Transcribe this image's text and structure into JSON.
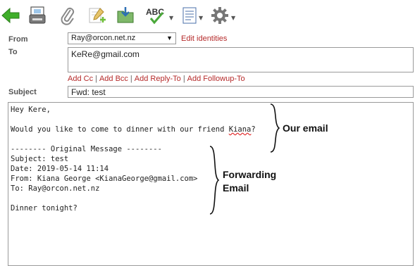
{
  "toolbar": {
    "items": [
      {
        "name": "back",
        "icon": "back-arrow-icon"
      },
      {
        "name": "send",
        "icon": "send-icon"
      },
      {
        "name": "attach",
        "icon": "paperclip-icon"
      },
      {
        "name": "signature",
        "icon": "signature-icon"
      },
      {
        "name": "save",
        "icon": "save-icon"
      },
      {
        "name": "spell",
        "icon": "spellcheck-icon",
        "text": "ABC"
      },
      {
        "name": "format",
        "icon": "document-format-icon"
      },
      {
        "name": "options",
        "icon": "gear-icon"
      }
    ]
  },
  "form": {
    "from_label": "From",
    "from_value": "Ray@orcon.net.nz",
    "edit_identities": "Edit identities",
    "to_label": "To",
    "to_value": "KeRe@gmail.com",
    "add_cc": "Add Cc",
    "add_bcc": "Add Bcc",
    "add_reply_to": "Add Reply-To",
    "add_followup_to": "Add Followup-To",
    "subject_label": "Subject",
    "subject_value": "Fwd: test"
  },
  "message": {
    "line1": "Hey Kere,",
    "line2_before": "Would you like to come to dinner with our friend ",
    "line2_word": "Kiana",
    "line2_after": "?",
    "original_header": "-------- Original Message --------",
    "orig_subject": "Subject: test",
    "orig_date": "Date: 2019-05-14 11:14",
    "orig_from": "From: Kiana George <KianaGeorge@gmail.com>",
    "orig_to": "To: Ray@orcon.net.nz",
    "orig_body": "Dinner tonight?"
  },
  "annotations": {
    "our_email": "Our email",
    "forwarding_line1": "Forwarding",
    "forwarding_line2": "Email"
  },
  "colors": {
    "link": "#b52a2a",
    "green_arrow": "#3fae2a",
    "border": "#9a9a9a"
  }
}
